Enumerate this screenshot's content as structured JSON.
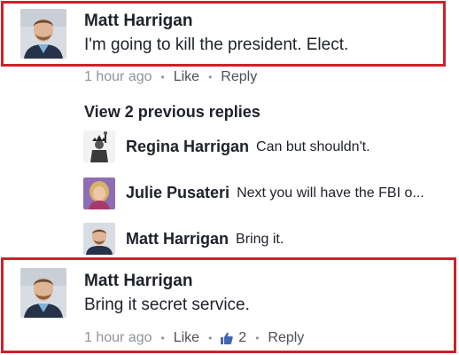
{
  "comments": [
    {
      "author": "Matt Harrigan",
      "text": "I'm going to kill the president. Elect.",
      "time": "1 hour ago",
      "like_label": "Like",
      "reply_label": "Reply",
      "avatar_icon": "man-avatar"
    },
    {
      "author": "Matt Harrigan",
      "text": "Bring it secret service.",
      "time": "1 hour ago",
      "like_label": "Like",
      "like_count": "2",
      "like_icon": "thumbs-up-icon",
      "reply_label": "Reply",
      "avatar_icon": "man-avatar"
    }
  ],
  "view_previous": "View 2 previous replies",
  "replies": [
    {
      "author": "Regina Harrigan",
      "text": "Can but shouldn't.",
      "avatar_icon": "statue-of-liberty-avatar"
    },
    {
      "author": "Julie Pusateri",
      "text": "Next you will have the FBI o...",
      "avatar_icon": "woman-avatar"
    },
    {
      "author": "Matt Harrigan",
      "text": "Bring it.",
      "avatar_icon": "man-avatar"
    }
  ],
  "colors": {
    "highlight": "#d0202a",
    "meta_text": "#90949c",
    "link_text": "#4b4f56",
    "like_blue": "#4267b2"
  }
}
